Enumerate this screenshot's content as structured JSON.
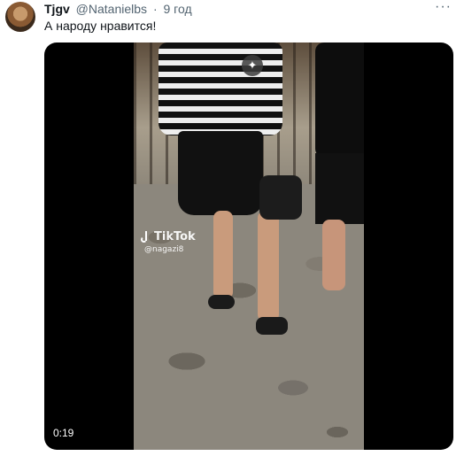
{
  "tweet": {
    "display_name": "Tjgv",
    "handle": "@Natanielbs",
    "separator": "·",
    "time": "9 год",
    "more_label": "···",
    "text": "А народу нравится!"
  },
  "media": {
    "watermark_brand": "TikTok",
    "watermark_user": "@nagazi8",
    "sparkle_icon": "sparkle-icon",
    "duration": "0:19"
  }
}
